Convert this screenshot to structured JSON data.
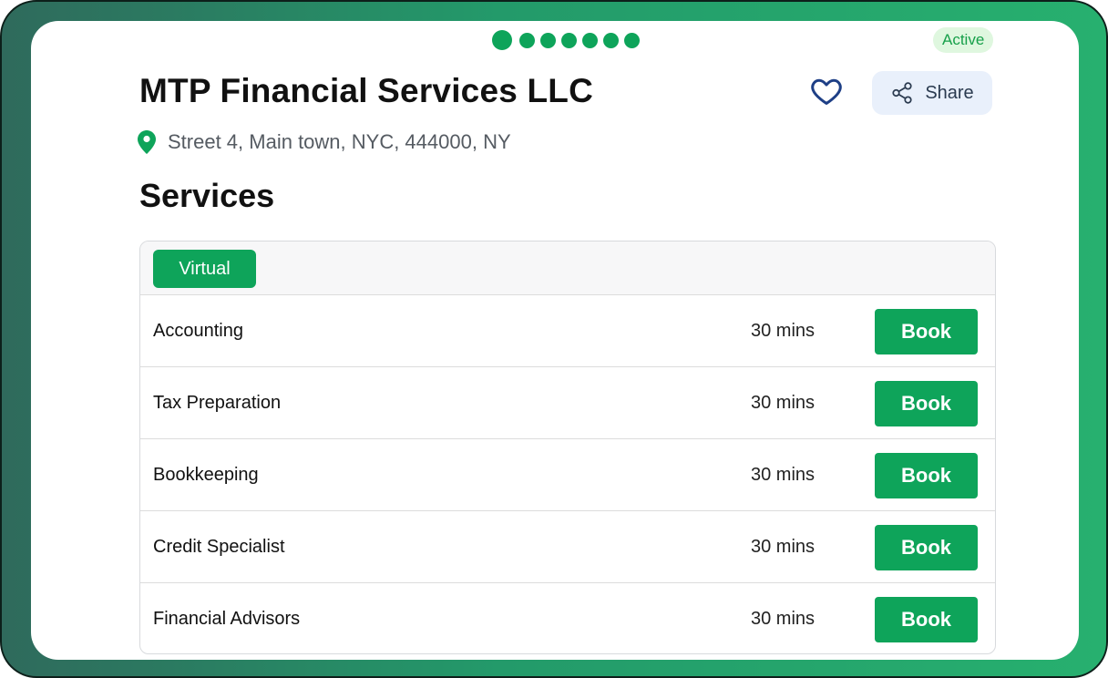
{
  "pagination": {
    "count": 7,
    "active_index": 0
  },
  "status": {
    "label": "Active",
    "color": "#17a04a",
    "bg": "#dff7df"
  },
  "business": {
    "name": "MTP Financial Services LLC",
    "address": "Street 4, Main town, NYC, 444000, NY"
  },
  "actions": {
    "favorite_icon": "heart-icon",
    "share_label": "Share",
    "share_icon": "share-icon"
  },
  "services": {
    "heading": "Services",
    "tabs": [
      {
        "label": "Virtual"
      }
    ],
    "book_label": "Book",
    "items": [
      {
        "name": "Accounting",
        "duration": "30 mins"
      },
      {
        "name": "Tax Preparation",
        "duration": "30 mins"
      },
      {
        "name": "Bookkeeping",
        "duration": "30 mins"
      },
      {
        "name": "Credit Specialist",
        "duration": "30 mins"
      },
      {
        "name": "Financial Advisors",
        "duration": "30 mins"
      }
    ]
  },
  "colors": {
    "accent": "#0ea45a",
    "share_bg": "#e9f0fb",
    "heart": "#1e3f86"
  }
}
